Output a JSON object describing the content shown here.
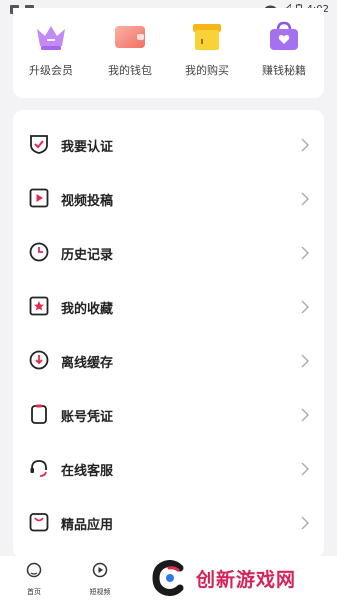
{
  "status_bar": {
    "time": "4:02"
  },
  "quick_actions": [
    {
      "label": "升级会员",
      "icon": "crown-icon",
      "color": "#b877f0"
    },
    {
      "label": "我的钱包",
      "icon": "wallet-icon",
      "color": "#f5837a"
    },
    {
      "label": "我的购买",
      "icon": "box-icon",
      "color": "#f7c51c"
    },
    {
      "label": "赚钱秘籍",
      "icon": "gift-bag-icon",
      "color": "#a56ef2"
    }
  ],
  "menu": [
    {
      "label": "我要认证",
      "icon": "shield-check-icon"
    },
    {
      "label": "视频投稿",
      "icon": "video-play-icon"
    },
    {
      "label": "历史记录",
      "icon": "clock-icon"
    },
    {
      "label": "我的收藏",
      "icon": "star-icon"
    },
    {
      "label": "离线缓存",
      "icon": "download-icon"
    },
    {
      "label": "账号凭证",
      "icon": "clipboard-icon"
    },
    {
      "label": "在线客服",
      "icon": "headset-icon"
    },
    {
      "label": "精品应用",
      "icon": "shopping-bag-icon"
    }
  ],
  "bottom_nav": [
    {
      "label": "首页",
      "icon": "home-icon"
    },
    {
      "label": "短视频",
      "icon": "play-circle-icon"
    }
  ],
  "watermark": {
    "text": "创新游戏网"
  },
  "colors": {
    "accent": "#e8294f",
    "background": "#f3f3f5",
    "card": "#ffffff"
  }
}
